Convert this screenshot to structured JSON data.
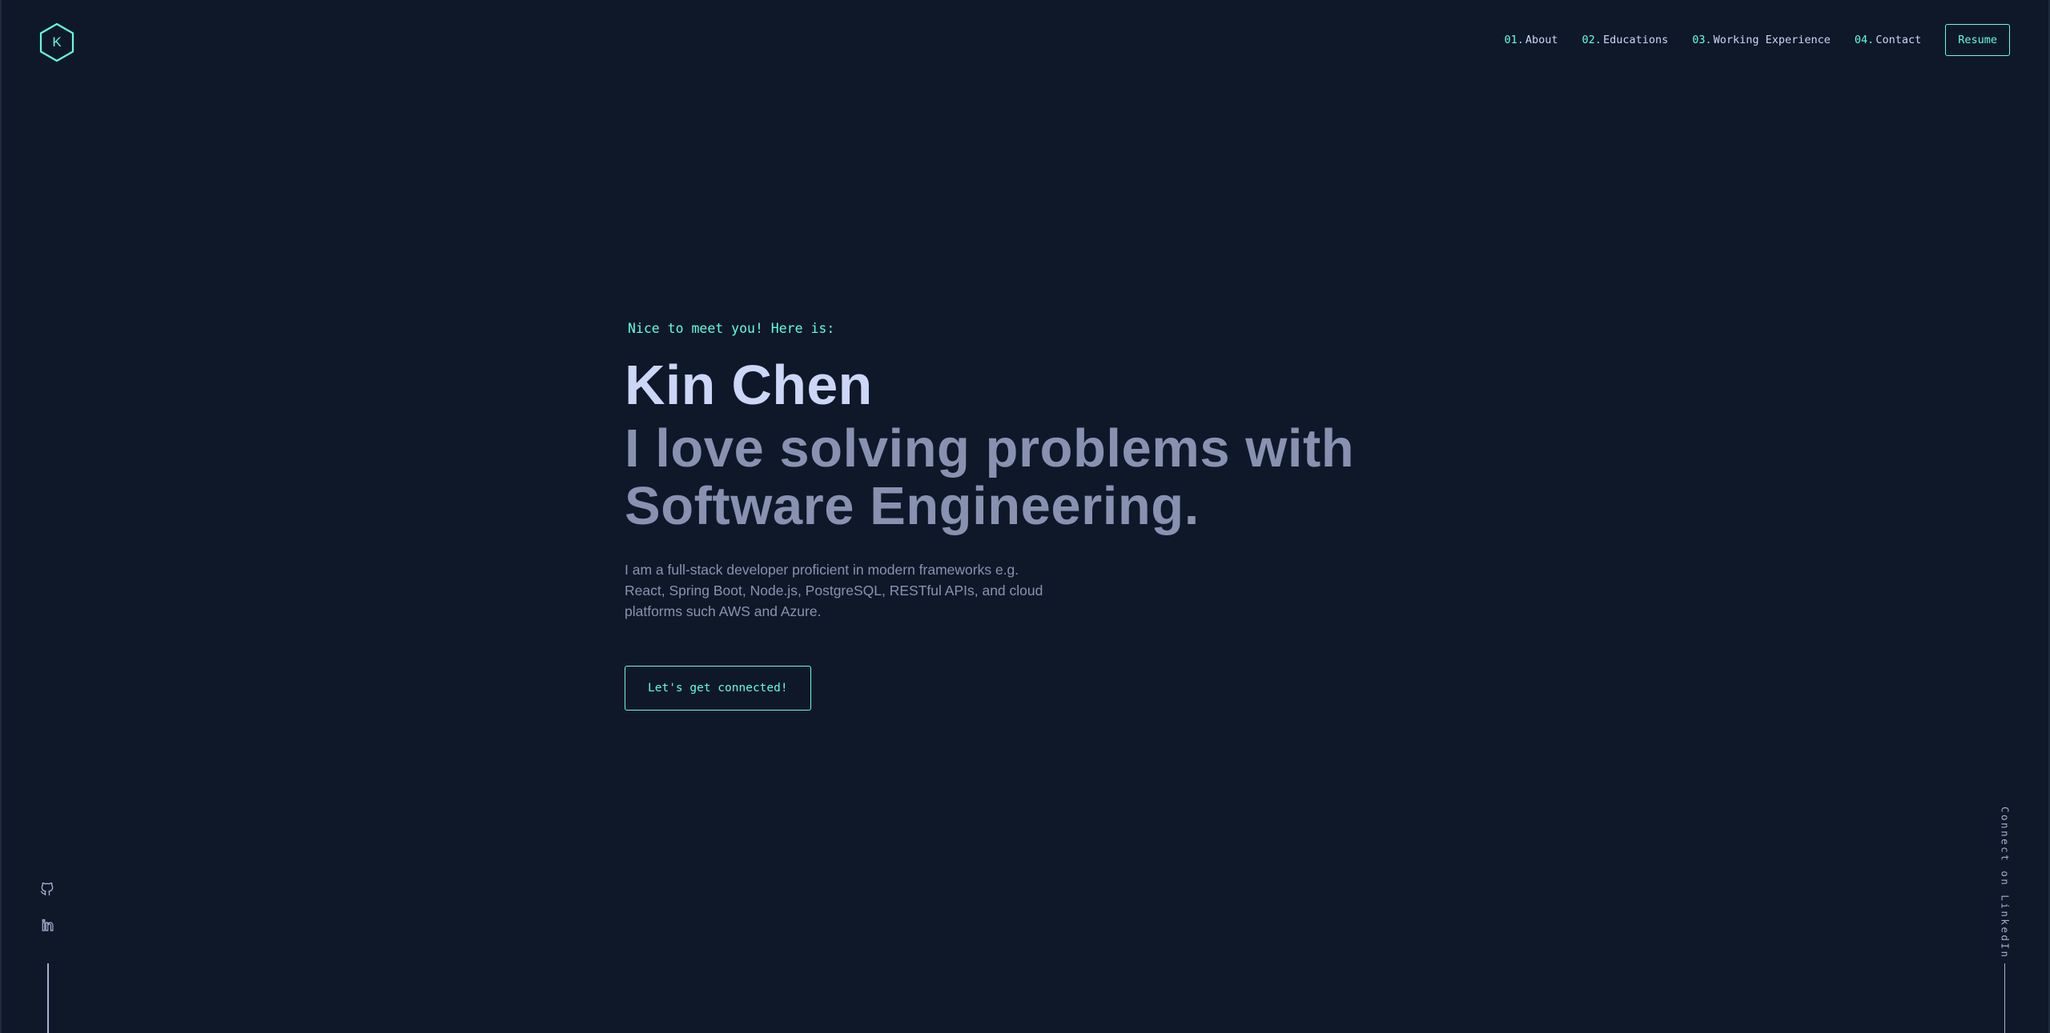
{
  "colors": {
    "background": "#0f1829",
    "accent": "#64ffda",
    "heading": "#ccd6f6",
    "text": "#8892b0",
    "muted_line": "#a8b2d1"
  },
  "header": {
    "logo_letter": "K",
    "logo_icon": "hexagon-logo-icon",
    "nav": [
      {
        "num": "01.",
        "label": "About"
      },
      {
        "num": "02.",
        "label": "Educations"
      },
      {
        "num": "03.",
        "label": "Working Experience"
      },
      {
        "num": "04.",
        "label": "Contact"
      }
    ],
    "resume_label": "Resume"
  },
  "hero": {
    "greeting": "Nice to meet you! Here is:",
    "name": "Kin Chen",
    "tagline_line1": "I love solving problems with",
    "tagline_line2": "Software Engineering.",
    "intro_line1": "I am a full-stack developer proficient in modern frameworks e.g.",
    "intro_line2": "React, Spring Boot, Node.js, PostgreSQL, RESTful APIs, and cloud",
    "intro_line3": "platforms such AWS and Azure.",
    "cta_label": "Let's get connected!"
  },
  "social": {
    "github_icon": "github-icon",
    "linkedin_icon": "linkedin-icon",
    "linkedin_glyph": "in"
  },
  "side_right": {
    "text": "Connect on LinkedIn"
  }
}
